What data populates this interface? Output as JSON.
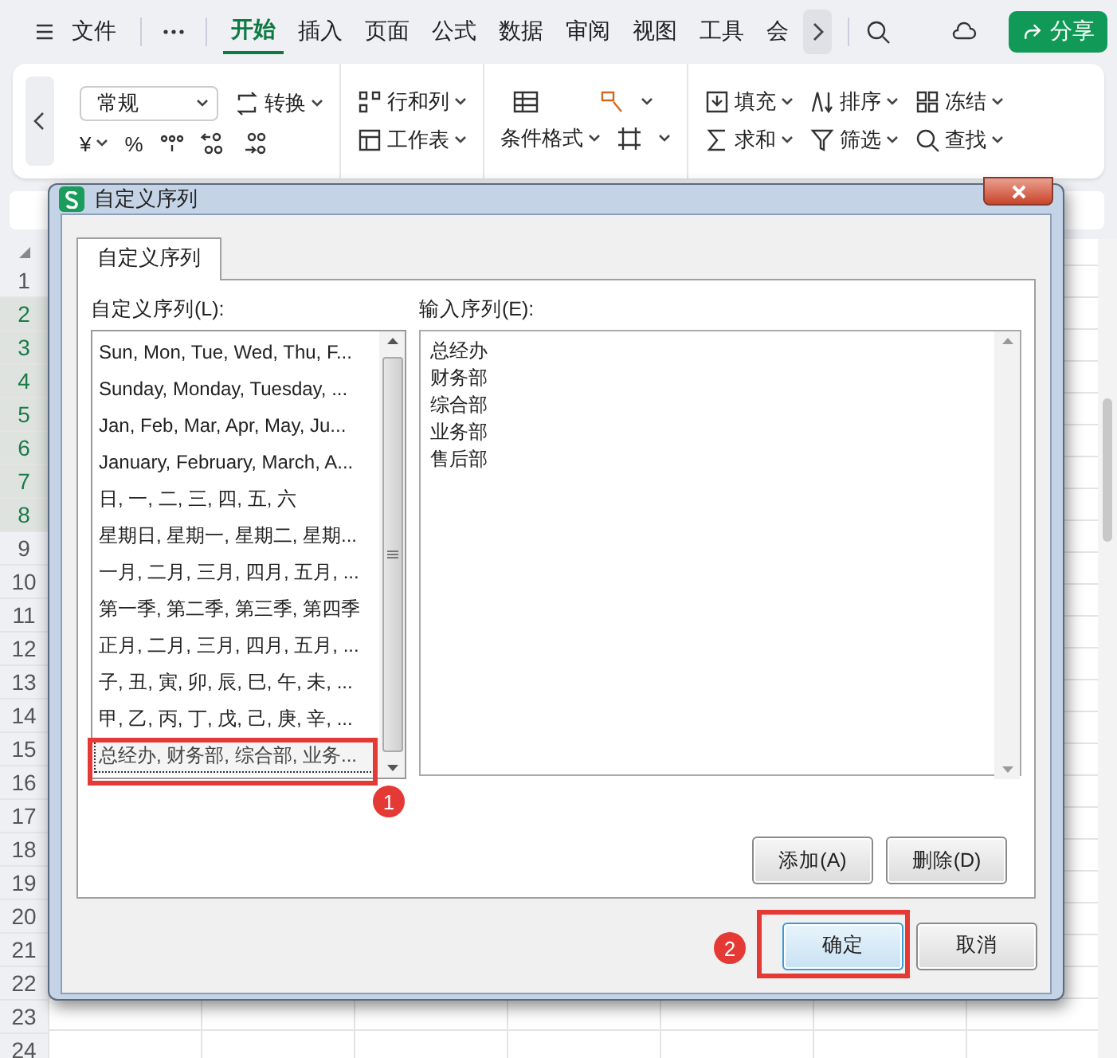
{
  "menu_bar": {
    "tabs": [
      {
        "label": "文件",
        "selected": false
      },
      {
        "label": "开始",
        "selected": true
      },
      {
        "label": "插入",
        "selected": false
      },
      {
        "label": "页面",
        "selected": false
      },
      {
        "label": "公式",
        "selected": false
      },
      {
        "label": "数据",
        "selected": false
      },
      {
        "label": "审阅",
        "selected": false
      },
      {
        "label": "视图",
        "selected": false
      },
      {
        "label": "工具",
        "selected": false
      },
      {
        "label": "会",
        "selected": false
      }
    ],
    "share_button": "分享"
  },
  "ribbon": {
    "number_format": "常规",
    "convert": "转换",
    "number_buttons": [
      "¥",
      "%"
    ],
    "rows_cols": "行和列",
    "worksheet": "工作表",
    "conditional_format": "条件格式",
    "fill": "填充",
    "sort": "排序",
    "freeze": "冻结",
    "sum": "求和",
    "filter": "筛选",
    "find": "查找"
  },
  "sheet": {
    "rows": [
      {
        "label": "1",
        "selected": false
      },
      {
        "label": "2",
        "selected": true
      },
      {
        "label": "3",
        "selected": true
      },
      {
        "label": "4",
        "selected": true
      },
      {
        "label": "5",
        "selected": true
      },
      {
        "label": "6",
        "selected": true
      },
      {
        "label": "7",
        "selected": true
      },
      {
        "label": "8",
        "selected": true
      },
      {
        "label": "9",
        "selected": false
      },
      {
        "label": "10",
        "selected": false
      },
      {
        "label": "11",
        "selected": false
      },
      {
        "label": "12",
        "selected": false
      },
      {
        "label": "13",
        "selected": false
      },
      {
        "label": "14",
        "selected": false
      },
      {
        "label": "15",
        "selected": false
      },
      {
        "label": "16",
        "selected": false
      },
      {
        "label": "17",
        "selected": false
      },
      {
        "label": "18",
        "selected": false
      },
      {
        "label": "19",
        "selected": false
      },
      {
        "label": "20",
        "selected": false
      },
      {
        "label": "21",
        "selected": false
      },
      {
        "label": "22",
        "selected": false
      },
      {
        "label": "23",
        "selected": false
      },
      {
        "label": "24",
        "selected": false
      }
    ]
  },
  "dialog": {
    "title": "自定义序列",
    "tabs": [
      {
        "label": "自定义序列",
        "selected": true
      }
    ],
    "list_label": "自定义序列(L):",
    "list_items": [
      {
        "text": "Sun, Mon, Tue, Wed, Thu, F...",
        "selected": false
      },
      {
        "text": "Sunday, Monday, Tuesday, ...",
        "selected": false
      },
      {
        "text": "Jan, Feb, Mar, Apr, May, Ju...",
        "selected": false
      },
      {
        "text": "January, February, March, A...",
        "selected": false
      },
      {
        "text": "日, 一, 二, 三, 四, 五, 六",
        "selected": false
      },
      {
        "text": "星期日, 星期一, 星期二, 星期...",
        "selected": false
      },
      {
        "text": "一月, 二月, 三月, 四月, 五月, ...",
        "selected": false
      },
      {
        "text": "第一季, 第二季, 第三季, 第四季",
        "selected": false
      },
      {
        "text": "正月, 二月, 三月, 四月, 五月, ...",
        "selected": false
      },
      {
        "text": "子, 丑, 寅, 卯, 辰, 巳, 午, 未, ...",
        "selected": false
      },
      {
        "text": "甲, 乙, 丙, 丁, 戊, 己, 庚, 辛, ...",
        "selected": false
      },
      {
        "text": "总经办, 财务部, 综合部, 业务...",
        "selected": true
      }
    ],
    "input_label": "输入序列(E):",
    "input_lines": [
      "总经办",
      "财务部",
      "综合部",
      "业务部",
      "售后部"
    ],
    "add_button": "添加(A)",
    "delete_button": "删除(D)",
    "ok_button": "确定",
    "cancel_button": "取消",
    "annotations": [
      {
        "number": "1"
      },
      {
        "number": "2"
      }
    ]
  }
}
